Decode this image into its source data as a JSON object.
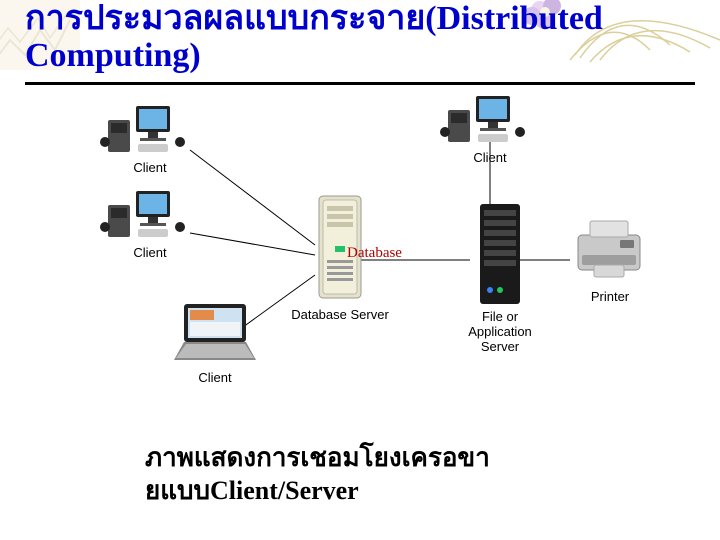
{
  "title": "การประมวลผลแบบกระจาย(Distributed Computing)",
  "nodes": {
    "client_top_left1": "Client",
    "client_top_left2": "Client",
    "client_top_right": "Client",
    "client_laptop": "Client",
    "database_label": "Database",
    "database_server": "Database Server",
    "app_server_line1": "File or",
    "app_server_line2": "Application",
    "app_server_line3": "Server",
    "printer": "Printer"
  },
  "caption_line1": "ภาพแสดงการเชอมโยงเครอขา",
  "caption_line2": "ยแบบClient/Server",
  "icons": {
    "workstation": "workstation-icon",
    "laptop": "laptop-icon",
    "tower_server": "tower-server-icon",
    "rack_server": "rack-server-icon",
    "printer": "printer-icon"
  }
}
